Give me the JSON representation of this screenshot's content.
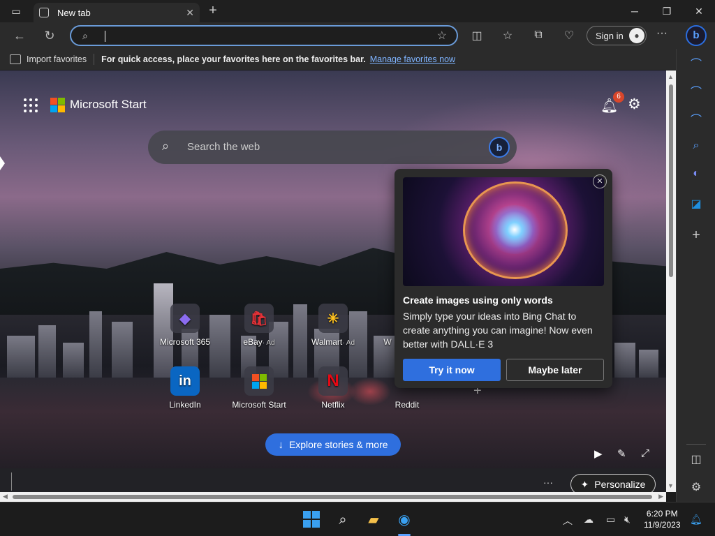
{
  "browser": {
    "tab_title": "New tab",
    "address_placeholder": "",
    "sign_in_label": "Sign in",
    "favorites_bar": {
      "import_label": "Import favorites",
      "message": "For quick access, place your favorites here on the favorites bar.",
      "manage_link": "Manage favorites now"
    }
  },
  "newtab": {
    "brand": "Microsoft Start",
    "notification_count": "6",
    "search_placeholder": "Search the web",
    "tiles": [
      {
        "label": "Microsoft 365",
        "ad": "",
        "icon": "microsoft-365-icon",
        "glyph": "◆",
        "color": "#8b6cf0"
      },
      {
        "label": "eBay",
        "ad": "· Ad",
        "icon": "ebay-icon",
        "glyph": "🛍",
        "color": "#e53238"
      },
      {
        "label": "Walmart",
        "ad": "· Ad",
        "icon": "walmart-icon",
        "glyph": "✳",
        "color": "#ffc220"
      },
      {
        "label": "W",
        "ad": "",
        "icon": "partial-tile-icon",
        "glyph": "",
        "color": "#888"
      },
      {
        "label": "LinkedIn",
        "ad": "",
        "icon": "linkedin-icon",
        "glyph": "in",
        "color": "#0a66c2"
      },
      {
        "label": "Microsoft Start",
        "ad": "",
        "icon": "microsoft-start-icon",
        "glyph": "",
        "color": "#f25022"
      },
      {
        "label": "Netflix",
        "ad": "",
        "icon": "netflix-icon",
        "glyph": "N",
        "color": "#e50914"
      },
      {
        "label": "Reddit",
        "ad": "",
        "icon": "reddit-icon",
        "glyph": "",
        "color": "#ff4500"
      }
    ],
    "explore_label": "Explore stories & more",
    "personalize_label": "Personalize"
  },
  "popup": {
    "title": "Create images using only words",
    "body": "Simply type your ideas into Bing Chat to create anything you can imagine! Now even better with DALL·E 3",
    "primary_button": "Try it now",
    "secondary_button": "Maybe later"
  },
  "taskbar": {
    "time": "6:20 PM",
    "date": "11/9/2023"
  },
  "colors": {
    "accent": "#2f6fde",
    "link": "#7fb4ff",
    "badge": "#d9462b"
  }
}
